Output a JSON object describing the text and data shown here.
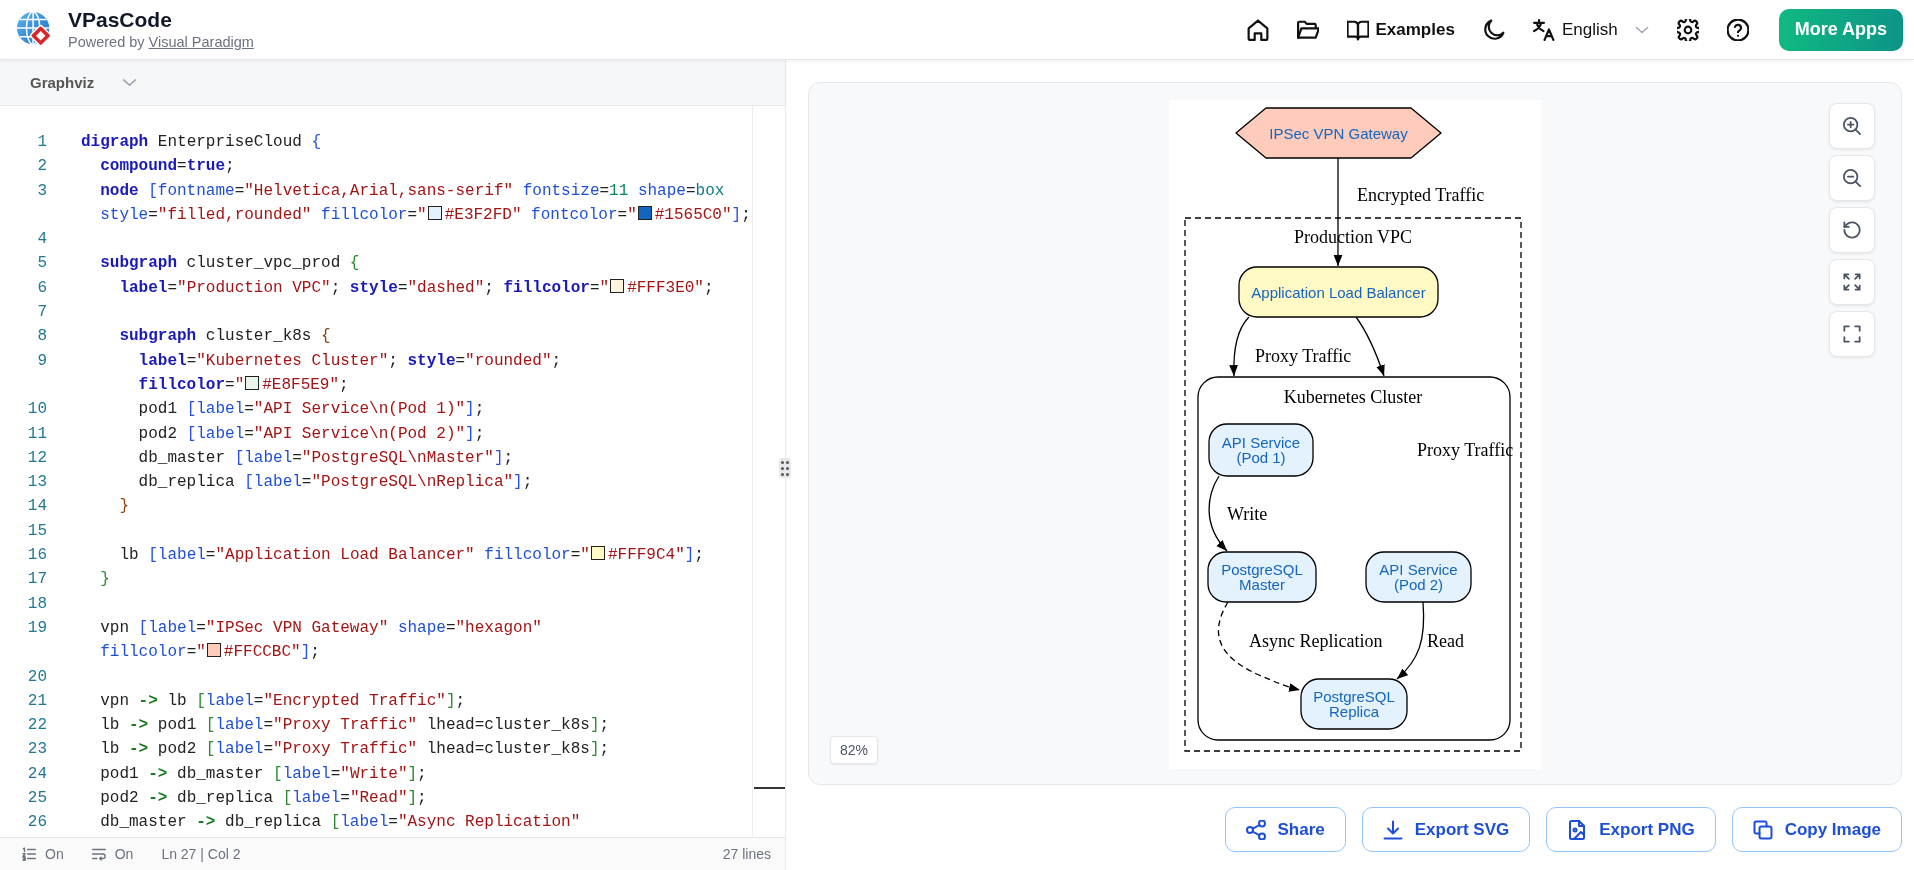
{
  "header": {
    "app_name": "VPasCode",
    "tagline": "Powered by",
    "tagline_link": "Visual Paradigm",
    "nav": [
      {
        "kind": "home"
      },
      {
        "kind": "folder"
      },
      {
        "kind": "examples",
        "label": "Examples"
      },
      {
        "kind": "theme"
      },
      {
        "kind": "language",
        "label": "English"
      },
      {
        "kind": "settings"
      },
      {
        "kind": "help"
      }
    ],
    "cta": "More Apps"
  },
  "editor": {
    "language": "Graphviz",
    "lines": [
      {
        "number": "1",
        "segments": [
          {
            "text": "digraph",
            "kind": "keyword"
          },
          {
            "text": " EnterpriseCloud ",
            "kind": "plain"
          },
          {
            "text": "{",
            "kind": "bracket1"
          }
        ]
      },
      {
        "number": "2",
        "segments": [
          {
            "text": "  compound",
            "kind": "keyword"
          },
          {
            "text": "=",
            "kind": "plain"
          },
          {
            "text": "true",
            "kind": "keyword"
          },
          {
            "text": ";",
            "kind": "plain"
          }
        ]
      },
      {
        "number": "3",
        "segments": [
          {
            "text": "  node",
            "kind": "keyword"
          },
          {
            "text": " [",
            "kind": "bracket1"
          },
          {
            "text": "fontname",
            "kind": "attribute"
          },
          {
            "text": "=",
            "kind": "plain"
          },
          {
            "text": "\"Helvetica,Arial,sans-serif\"",
            "kind": "string"
          },
          {
            "text": " fontsize",
            "kind": "attribute"
          },
          {
            "text": "=",
            "kind": "plain"
          },
          {
            "text": "11",
            "kind": "number"
          },
          {
            "text": " shape",
            "kind": "attribute"
          },
          {
            "text": "=",
            "kind": "plain"
          },
          {
            "text": "box",
            "kind": "value"
          }
        ]
      },
      {
        "segments": [
          {
            "text": "  style",
            "kind": "attribute"
          },
          {
            "text": "=",
            "kind": "plain"
          },
          {
            "text": "\"filled,rounded\"",
            "kind": "string"
          },
          {
            "text": " fillcolor",
            "kind": "attribute"
          },
          {
            "text": "=",
            "kind": "plain"
          },
          {
            "text": "\"",
            "kind": "string"
          },
          {
            "kind": "swatch",
            "color": "#e3f2fd"
          },
          {
            "text": "#E3F2FD\"",
            "kind": "string"
          },
          {
            "text": " fontcolor",
            "kind": "attribute"
          },
          {
            "text": "=",
            "kind": "plain"
          },
          {
            "text": "\"",
            "kind": "string"
          },
          {
            "kind": "swatch",
            "color": "#1565c0"
          },
          {
            "text": "#1565C0\"",
            "kind": "string"
          },
          {
            "text": "]",
            "kind": "bracket1"
          },
          {
            "text": ";",
            "kind": "plain"
          }
        ]
      },
      {
        "number": "4"
      },
      {
        "number": "5",
        "segments": [
          {
            "text": "  subgraph",
            "kind": "keyword"
          },
          {
            "text": " cluster_vpc_prod ",
            "kind": "plain"
          },
          {
            "text": "{",
            "kind": "bracket2"
          }
        ]
      },
      {
        "number": "6",
        "segments": [
          {
            "text": "    label",
            "kind": "keyword"
          },
          {
            "text": "=",
            "kind": "plain"
          },
          {
            "text": "\"Production VPC\"",
            "kind": "string"
          },
          {
            "text": "; ",
            "kind": "plain"
          },
          {
            "text": "style",
            "kind": "keyword"
          },
          {
            "text": "=",
            "kind": "plain"
          },
          {
            "text": "\"dashed\"",
            "kind": "string"
          },
          {
            "text": "; ",
            "kind": "plain"
          },
          {
            "text": "fillcolor",
            "kind": "keyword"
          },
          {
            "text": "=",
            "kind": "plain"
          },
          {
            "text": "\"",
            "kind": "string"
          },
          {
            "kind": "swatch",
            "color": "#fff3e0"
          },
          {
            "text": "#FFF3E0\"",
            "kind": "string"
          },
          {
            "text": ";",
            "kind": "plain"
          }
        ]
      },
      {
        "number": "7"
      },
      {
        "number": "8",
        "segments": [
          {
            "text": "    subgraph",
            "kind": "keyword"
          },
          {
            "text": " cluster_k8s ",
            "kind": "plain"
          },
          {
            "text": "{",
            "kind": "bracket3"
          }
        ]
      },
      {
        "number": "9",
        "segments": [
          {
            "text": "      label",
            "kind": "keyword"
          },
          {
            "text": "=",
            "kind": "plain"
          },
          {
            "text": "\"Kubernetes Cluster\"",
            "kind": "string"
          },
          {
            "text": "; ",
            "kind": "plain"
          },
          {
            "text": "style",
            "kind": "keyword"
          },
          {
            "text": "=",
            "kind": "plain"
          },
          {
            "text": "\"rounded\"",
            "kind": "string"
          },
          {
            "text": ";",
            "kind": "plain"
          }
        ]
      },
      {
        "segments": [
          {
            "text": "      fillcolor",
            "kind": "keyword"
          },
          {
            "text": "=",
            "kind": "plain"
          },
          {
            "text": "\"",
            "kind": "string"
          },
          {
            "kind": "swatch",
            "color": "#e8f5e9"
          },
          {
            "text": "#E8F5E9\"",
            "kind": "string"
          },
          {
            "text": ";",
            "kind": "plain"
          }
        ]
      },
      {
        "number": "10",
        "segments": [
          {
            "text": "      pod1 ",
            "kind": "plain"
          },
          {
            "text": "[",
            "kind": "bracket1"
          },
          {
            "text": "label",
            "kind": "attribute"
          },
          {
            "text": "=",
            "kind": "plain"
          },
          {
            "text": "\"API Service\\n(Pod 1)\"",
            "kind": "string"
          },
          {
            "text": "]",
            "kind": "bracket1"
          },
          {
            "text": ";",
            "kind": "plain"
          }
        ]
      },
      {
        "number": "11",
        "segments": [
          {
            "text": "      pod2 ",
            "kind": "plain"
          },
          {
            "text": "[",
            "kind": "bracket1"
          },
          {
            "text": "label",
            "kind": "attribute"
          },
          {
            "text": "=",
            "kind": "plain"
          },
          {
            "text": "\"API Service\\n(Pod 2)\"",
            "kind": "string"
          },
          {
            "text": "]",
            "kind": "bracket1"
          },
          {
            "text": ";",
            "kind": "plain"
          }
        ]
      },
      {
        "number": "12",
        "segments": [
          {
            "text": "      db_master ",
            "kind": "plain"
          },
          {
            "text": "[",
            "kind": "bracket1"
          },
          {
            "text": "label",
            "kind": "attribute"
          },
          {
            "text": "=",
            "kind": "plain"
          },
          {
            "text": "\"PostgreSQL\\nMaster\"",
            "kind": "string"
          },
          {
            "text": "]",
            "kind": "bracket1"
          },
          {
            "text": ";",
            "kind": "plain"
          }
        ]
      },
      {
        "number": "13",
        "segments": [
          {
            "text": "      db_replica ",
            "kind": "plain"
          },
          {
            "text": "[",
            "kind": "bracket1"
          },
          {
            "text": "label",
            "kind": "attribute"
          },
          {
            "text": "=",
            "kind": "plain"
          },
          {
            "text": "\"PostgreSQL\\nReplica\"",
            "kind": "string"
          },
          {
            "text": "]",
            "kind": "bracket1"
          },
          {
            "text": ";",
            "kind": "plain"
          }
        ]
      },
      {
        "number": "14",
        "segments": [
          {
            "text": "    }",
            "kind": "bracket3"
          }
        ]
      },
      {
        "number": "15"
      },
      {
        "number": "16",
        "segments": [
          {
            "text": "    lb ",
            "kind": "plain"
          },
          {
            "text": "[",
            "kind": "bracket1"
          },
          {
            "text": "label",
            "kind": "attribute"
          },
          {
            "text": "=",
            "kind": "plain"
          },
          {
            "text": "\"Application Load Balancer\"",
            "kind": "string"
          },
          {
            "text": " fillcolor",
            "kind": "attribute"
          },
          {
            "text": "=",
            "kind": "plain"
          },
          {
            "text": "\"",
            "kind": "string"
          },
          {
            "kind": "swatch",
            "color": "#fff9c4"
          },
          {
            "text": "#FFF9C4\"",
            "kind": "string"
          },
          {
            "text": "]",
            "kind": "bracket1"
          },
          {
            "text": ";",
            "kind": "plain"
          }
        ]
      },
      {
        "number": "17",
        "segments": [
          {
            "text": "  }",
            "kind": "bracket2"
          }
        ]
      },
      {
        "number": "18"
      },
      {
        "number": "19",
        "segments": [
          {
            "text": "  vpn ",
            "kind": "plain"
          },
          {
            "text": "[",
            "kind": "bracket1"
          },
          {
            "text": "label",
            "kind": "attribute"
          },
          {
            "text": "=",
            "kind": "plain"
          },
          {
            "text": "\"IPSec VPN Gateway\"",
            "kind": "string"
          },
          {
            "text": " shape",
            "kind": "attribute"
          },
          {
            "text": "=",
            "kind": "plain"
          },
          {
            "text": "\"hexagon\"",
            "kind": "string"
          }
        ]
      },
      {
        "segments": [
          {
            "text": "  fillcolor",
            "kind": "attribute"
          },
          {
            "text": "=",
            "kind": "plain"
          },
          {
            "text": "\"",
            "kind": "string"
          },
          {
            "kind": "swatch",
            "color": "#ffccbc"
          },
          {
            "text": "#FFCCBC\"",
            "kind": "string"
          },
          {
            "text": "]",
            "kind": "bracket1"
          },
          {
            "text": ";",
            "kind": "plain"
          }
        ]
      },
      {
        "number": "20"
      },
      {
        "number": "21",
        "segments": [
          {
            "text": "  vpn ",
            "kind": "plain"
          },
          {
            "text": "->",
            "kind": "arrow"
          },
          {
            "text": " lb ",
            "kind": "plain"
          },
          {
            "text": "[",
            "kind": "bracket2"
          },
          {
            "text": "label",
            "kind": "attribute"
          },
          {
            "text": "=",
            "kind": "plain"
          },
          {
            "text": "\"Encrypted Traffic\"",
            "kind": "string"
          },
          {
            "text": "]",
            "kind": "bracket2"
          },
          {
            "text": ";",
            "kind": "plain"
          }
        ]
      },
      {
        "number": "22",
        "segments": [
          {
            "text": "  lb ",
            "kind": "plain"
          },
          {
            "text": "->",
            "kind": "arrow"
          },
          {
            "text": " pod1 ",
            "kind": "plain"
          },
          {
            "text": "[",
            "kind": "bracket2"
          },
          {
            "text": "label",
            "kind": "attribute"
          },
          {
            "text": "=",
            "kind": "plain"
          },
          {
            "text": "\"Proxy Traffic\"",
            "kind": "string"
          },
          {
            "text": " lhead=cluster_k8s",
            "kind": "plain"
          },
          {
            "text": "]",
            "kind": "bracket2"
          },
          {
            "text": ";",
            "kind": "plain"
          }
        ]
      },
      {
        "number": "23",
        "segments": [
          {
            "text": "  lb ",
            "kind": "plain"
          },
          {
            "text": "->",
            "kind": "arrow"
          },
          {
            "text": " pod2 ",
            "kind": "plain"
          },
          {
            "text": "[",
            "kind": "bracket2"
          },
          {
            "text": "label",
            "kind": "attribute"
          },
          {
            "text": "=",
            "kind": "plain"
          },
          {
            "text": "\"Proxy Traffic\"",
            "kind": "string"
          },
          {
            "text": " lhead=cluster_k8s",
            "kind": "plain"
          },
          {
            "text": "]",
            "kind": "bracket2"
          },
          {
            "text": ";",
            "kind": "plain"
          }
        ]
      },
      {
        "number": "24",
        "segments": [
          {
            "text": "  pod1 ",
            "kind": "plain"
          },
          {
            "text": "->",
            "kind": "arrow"
          },
          {
            "text": " db_master ",
            "kind": "plain"
          },
          {
            "text": "[",
            "kind": "bracket2"
          },
          {
            "text": "label",
            "kind": "attribute"
          },
          {
            "text": "=",
            "kind": "plain"
          },
          {
            "text": "\"Write\"",
            "kind": "string"
          },
          {
            "text": "]",
            "kind": "bracket2"
          },
          {
            "text": ";",
            "kind": "plain"
          }
        ]
      },
      {
        "number": "25",
        "segments": [
          {
            "text": "  pod2 ",
            "kind": "plain"
          },
          {
            "text": "->",
            "kind": "arrow"
          },
          {
            "text": " db_replica ",
            "kind": "plain"
          },
          {
            "text": "[",
            "kind": "bracket2"
          },
          {
            "text": "label",
            "kind": "attribute"
          },
          {
            "text": "=",
            "kind": "plain"
          },
          {
            "text": "\"Read\"",
            "kind": "string"
          },
          {
            "text": "]",
            "kind": "bracket2"
          },
          {
            "text": ";",
            "kind": "plain"
          }
        ]
      },
      {
        "number": "26",
        "segments": [
          {
            "text": "  db_master ",
            "kind": "plain"
          },
          {
            "text": "->",
            "kind": "arrow"
          },
          {
            "text": " db_replica ",
            "kind": "plain"
          },
          {
            "text": "[",
            "kind": "bracket2"
          },
          {
            "text": "label",
            "kind": "attribute"
          },
          {
            "text": "=",
            "kind": "plain"
          },
          {
            "text": "\"Async Replication\"",
            "kind": "string"
          }
        ]
      }
    ],
    "status": {
      "toggles": [
        {
          "kind": "line-numbers",
          "label": "On"
        },
        {
          "kind": "wrap",
          "label": "On"
        }
      ],
      "cursor": "Ln 27 | Col 2",
      "line_count": "27 lines"
    }
  },
  "preview": {
    "tools": [
      {
        "kind": "zoom-in"
      },
      {
        "kind": "zoom-out"
      },
      {
        "kind": "reset"
      },
      {
        "kind": "fit"
      },
      {
        "kind": "fullscreen"
      }
    ],
    "zoom": "82%",
    "diagram": {
      "clusters": [
        {
          "label": "Production VPC",
          "kind": "dashed"
        },
        {
          "label": "Kubernetes Cluster",
          "kind": "rounded"
        }
      ],
      "nodes": [
        {
          "lines": [
            "IPSec VPN Gateway"
          ],
          "kind": "hexagon",
          "color": "#ffccbc"
        },
        {
          "lines": [
            "Application Load Balancer"
          ],
          "kind": "rounded",
          "color": "#fff9c4"
        },
        {
          "lines": [
            "API Service",
            "(Pod 1)"
          ],
          "kind": "rounded",
          "color": "#e3f2fd"
        },
        {
          "lines": [
            "PostgreSQL",
            "Master"
          ],
          "kind": "rounded",
          "color": "#e3f2fd"
        },
        {
          "lines": [
            "API Service",
            "(Pod 2)"
          ],
          "kind": "rounded",
          "color": "#e3f2fd"
        },
        {
          "lines": [
            "PostgreSQL",
            "Replica"
          ],
          "kind": "rounded",
          "color": "#e3f2fd"
        }
      ],
      "edges": [
        {
          "label": "Encrypted Traffic",
          "kind": "solid"
        },
        {
          "label": "Proxy Traffic",
          "kind": "solid"
        },
        {
          "label": "Proxy Traffic",
          "kind": "solid"
        },
        {
          "label": "Write",
          "kind": "solid"
        },
        {
          "label": "Read",
          "kind": "solid"
        },
        {
          "label": "Async Replication",
          "kind": "dashed"
        }
      ]
    }
  },
  "actions": [
    {
      "kind": "share",
      "label": "Share"
    },
    {
      "kind": "export-svg",
      "label": "Export SVG"
    },
    {
      "kind": "export-png",
      "label": "Export PNG"
    },
    {
      "kind": "copy",
      "label": "Copy Image"
    }
  ]
}
